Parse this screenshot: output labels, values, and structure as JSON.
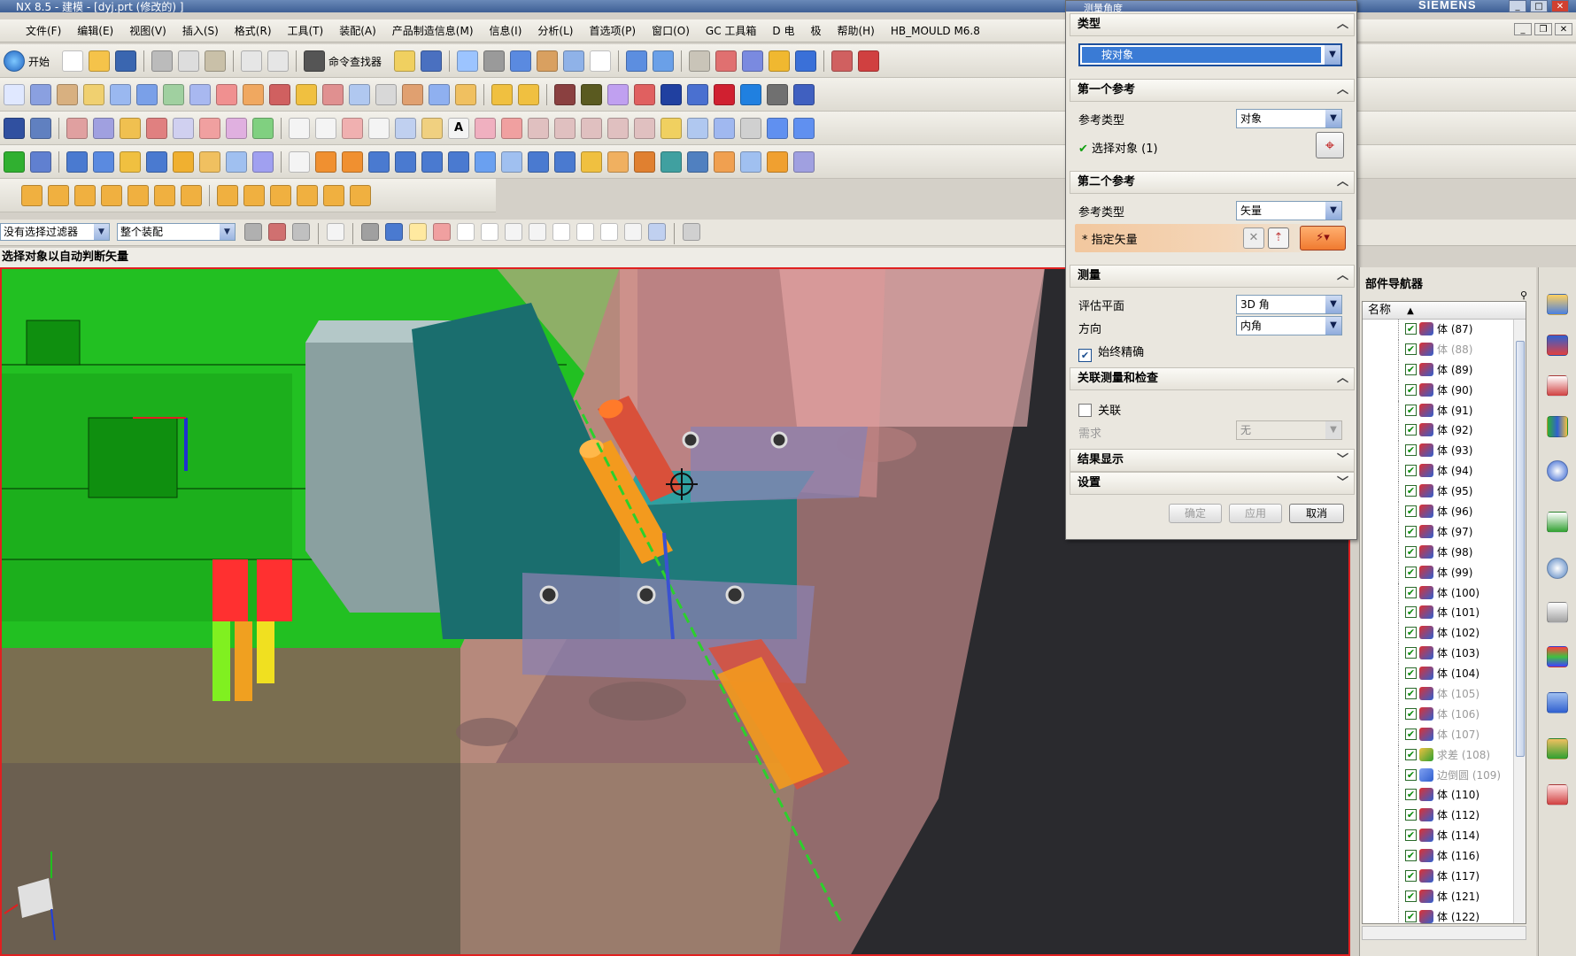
{
  "window": {
    "title": "NX 8.5 - 建模 - [dyj.prt (修改的) ]",
    "brand": "SIEMENS"
  },
  "menu": [
    "文件(F)",
    "编辑(E)",
    "视图(V)",
    "插入(S)",
    "格式(R)",
    "工具(T)",
    "装配(A)",
    "产品制造信息(M)",
    "信息(I)",
    "分析(L)",
    "首选项(P)",
    "窗口(O)",
    "GC 工具箱",
    "D 电",
    "极",
    "帮助(H)",
    "HB_MOULD M6.8"
  ],
  "toolbar": {
    "start_label": "开始",
    "command_finder_label": "命令查找器"
  },
  "selection_bar": {
    "filter": "没有选择过滤器",
    "scope": "整个装配"
  },
  "cue_line": "选择对象以自动判断矢量",
  "dialog": {
    "title": "测量角度",
    "sections": {
      "type": "类型",
      "first_ref": "第一个参考",
      "second_ref": "第二个参考",
      "measure": "测量",
      "assoc": "关联测量和检查",
      "results": "结果显示",
      "settings": "设置"
    },
    "type_value": "按对象",
    "first": {
      "ref_type_label": "参考类型",
      "ref_type_value": "对象",
      "select_label": "选择对象 (1)"
    },
    "second": {
      "ref_type_label": "参考类型",
      "ref_type_value": "矢量",
      "specify_label": "* 指定矢量"
    },
    "measure": {
      "eval_plane_label": "评估平面",
      "eval_plane_value": "3D 角",
      "direction_label": "方向",
      "direction_value": "内角",
      "always_precise": "始终精确"
    },
    "assoc": {
      "assoc_label": "关联",
      "requirement_label": "需求",
      "requirement_value": "无"
    },
    "buttons": {
      "ok": "确定",
      "apply": "应用",
      "cancel": "取消"
    }
  },
  "navigator": {
    "title": "部件导航器",
    "column": "名称",
    "items": [
      {
        "name": "体 (87)",
        "dim": false,
        "icon": "body"
      },
      {
        "name": "体 (88)",
        "dim": true,
        "icon": "body"
      },
      {
        "name": "体 (89)",
        "dim": false,
        "icon": "body"
      },
      {
        "name": "体 (90)",
        "dim": false,
        "icon": "body"
      },
      {
        "name": "体 (91)",
        "dim": false,
        "icon": "body"
      },
      {
        "name": "体 (92)",
        "dim": false,
        "icon": "body"
      },
      {
        "name": "体 (93)",
        "dim": false,
        "icon": "body"
      },
      {
        "name": "体 (94)",
        "dim": false,
        "icon": "body"
      },
      {
        "name": "体 (95)",
        "dim": false,
        "icon": "body"
      },
      {
        "name": "体 (96)",
        "dim": false,
        "icon": "body"
      },
      {
        "name": "体 (97)",
        "dim": false,
        "icon": "body"
      },
      {
        "name": "体 (98)",
        "dim": false,
        "icon": "body"
      },
      {
        "name": "体 (99)",
        "dim": false,
        "icon": "body"
      },
      {
        "name": "体 (100)",
        "dim": false,
        "icon": "body"
      },
      {
        "name": "体 (101)",
        "dim": false,
        "icon": "body"
      },
      {
        "name": "体 (102)",
        "dim": false,
        "icon": "body"
      },
      {
        "name": "体 (103)",
        "dim": false,
        "icon": "body"
      },
      {
        "name": "体 (104)",
        "dim": false,
        "icon": "body"
      },
      {
        "name": "体 (105)",
        "dim": true,
        "icon": "body"
      },
      {
        "name": "体 (106)",
        "dim": true,
        "icon": "body"
      },
      {
        "name": "体 (107)",
        "dim": true,
        "icon": "body"
      },
      {
        "name": "求差 (108)",
        "dim": true,
        "icon": "subtract"
      },
      {
        "name": "边倒圆 (109)",
        "dim": true,
        "icon": "blend"
      },
      {
        "name": "体 (110)",
        "dim": false,
        "icon": "body"
      },
      {
        "name": "体 (112)",
        "dim": false,
        "icon": "body"
      },
      {
        "name": "体 (114)",
        "dim": false,
        "icon": "body"
      },
      {
        "name": "体 (116)",
        "dim": false,
        "icon": "body"
      },
      {
        "name": "体 (117)",
        "dim": false,
        "icon": "body"
      },
      {
        "name": "体 (121)",
        "dim": false,
        "icon": "body"
      },
      {
        "name": "体 (122)",
        "dim": false,
        "icon": "body"
      }
    ]
  },
  "colors": {
    "part_green": "#22c022",
    "teal_block": "#1f7a7a",
    "pink_transparent": "#e8a0a0",
    "orange_pin": "#f39a1e",
    "dialog_highlight": "#3a7bd5"
  }
}
